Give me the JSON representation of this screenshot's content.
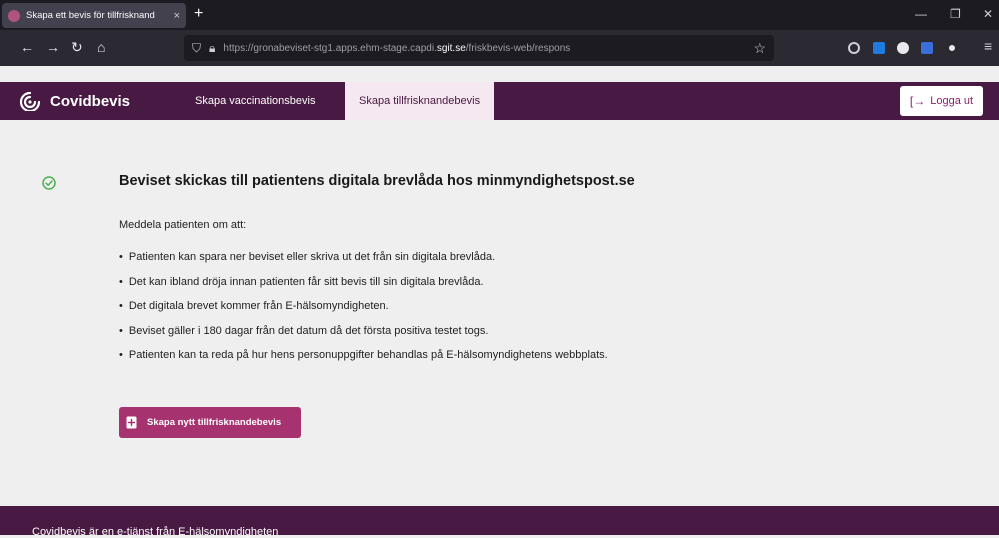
{
  "browser": {
    "tab_title": "Skapa ett bevis för tillfrisknand",
    "tab_close": "×",
    "new_tab": "+",
    "url_host_prefix": "https://gronabeviset-stg1.apps.ehm-stage.capdi.",
    "url_host_domain": "sgit.se",
    "url_path": "/friskbevis-web/respons",
    "minimize": "—",
    "restore": "❐",
    "close": "✕",
    "back": "←",
    "forward": "→",
    "reload": "↻",
    "home": "⌂",
    "bookmark": "☆",
    "menu": "≡"
  },
  "header": {
    "brand": "Covidbevis",
    "tabs": [
      "Skapa vaccinationsbevis",
      "Skapa tillfrisknandebevis"
    ],
    "active_tab": 1,
    "logout_label": "Logga ut",
    "logout_icon": "[→",
    "colors": {
      "primary": "#481942",
      "active_tab_bg": "#f5e8f0",
      "accent": "#a6336f",
      "success": "#4caf50"
    }
  },
  "main": {
    "heading": "Beviset skickas till patientens digitala brevlåda hos minmyndighetspost.se",
    "intro": "Meddela patienten om att:",
    "bullets": [
      "Patienten kan spara ner beviset eller skriva ut det från sin digitala brevlåda.",
      "Det kan ibland dröja innan patienten får sitt bevis till sin digitala brevlåda.",
      "Det digitala brevet kommer från E-hälsomyndigheten.",
      "Beviset gäller i 180 dagar från det datum då det första positiva testet togs.",
      "Patienten kan ta reda på hur hens personuppgifter behandlas på E-hälsomyndighetens webbplats."
    ],
    "button_label": "Skapa nytt tillfrisknandebevis"
  },
  "footer": {
    "text": "Covidbevis är en e-tjänst från E-hälsomyndigheten"
  }
}
